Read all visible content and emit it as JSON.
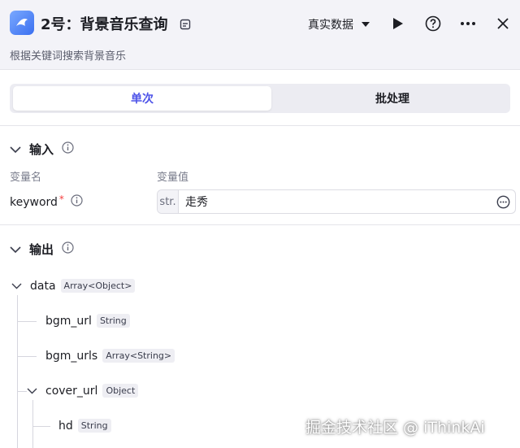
{
  "header": {
    "title": "2号：背景音乐查询",
    "subtitle": "根据关键词搜索背景音乐",
    "mode_label": "真实数据",
    "icons": [
      "app-logo-icon",
      "edit-icon",
      "chevron-down-icon",
      "play-icon",
      "help-icon",
      "more-icon",
      "close-icon"
    ]
  },
  "tabs": [
    {
      "label": "单次",
      "active": true
    },
    {
      "label": "批处理",
      "active": false
    }
  ],
  "input_section": {
    "title": "输入",
    "col_name": "变量名",
    "col_value": "变量值",
    "param": {
      "name": "keyword",
      "required_mark": "*",
      "type_tag": "str.",
      "value": "走秀"
    }
  },
  "output_section": {
    "title": "输出",
    "tree": [
      {
        "name": "data",
        "type": "Array<Object>"
      },
      {
        "name": "bgm_url",
        "type": "String"
      },
      {
        "name": "bgm_urls",
        "type": "Array<String>"
      },
      {
        "name": "cover_url",
        "type": "Object"
      },
      {
        "name": "hd",
        "type": "String"
      }
    ]
  },
  "watermark": "掘金技术社区 @ iThinkAi",
  "colors": {
    "accent": "#4d53e8",
    "required": "#f53f3f",
    "header_bg": "#f3f3f8"
  }
}
